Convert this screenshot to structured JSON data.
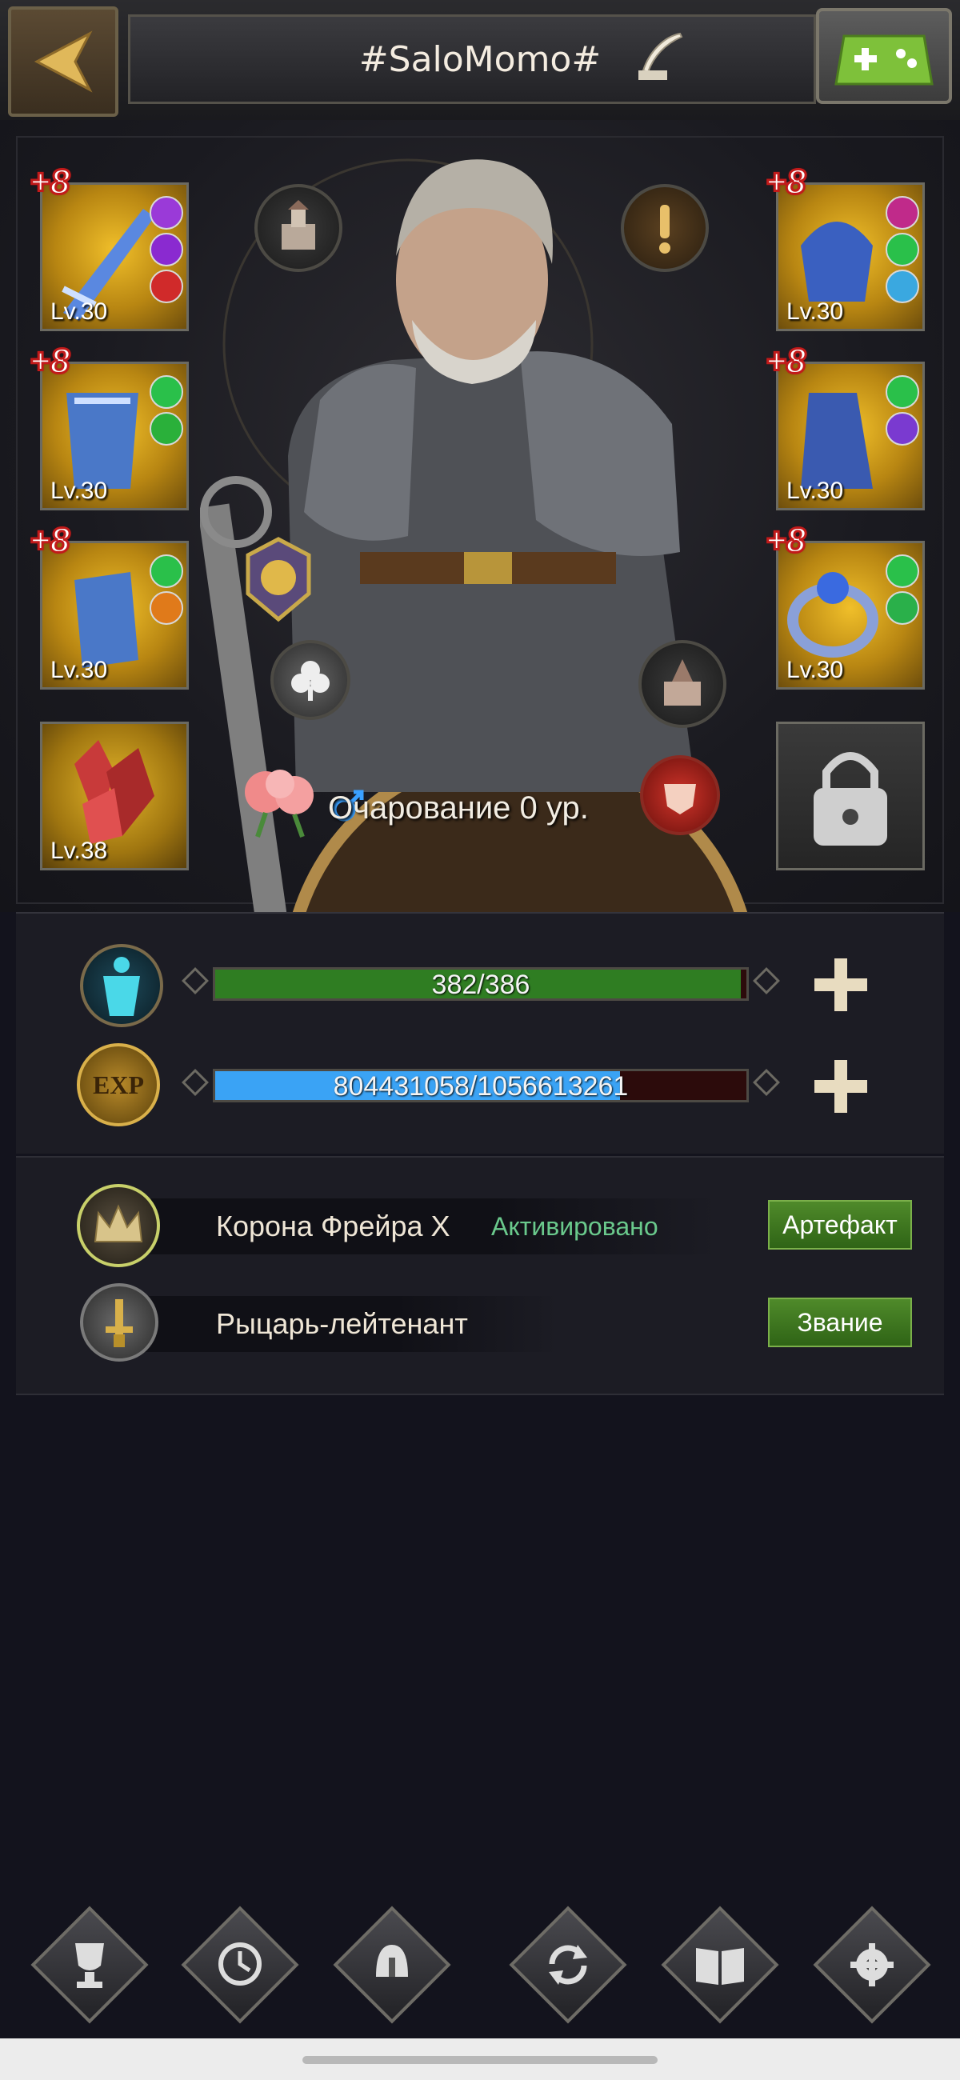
{
  "header": {
    "title": "#SaloMomo#"
  },
  "equipment": {
    "left": [
      {
        "plus": "+8",
        "level": "Lv.30"
      },
      {
        "plus": "+8",
        "level": "Lv.30"
      },
      {
        "plus": "+8",
        "level": "Lv.30"
      },
      {
        "plus": "",
        "level": "Lv.38"
      }
    ],
    "right": [
      {
        "plus": "+8",
        "level": "Lv.30"
      },
      {
        "plus": "+8",
        "level": "Lv.30"
      },
      {
        "plus": "+8",
        "level": "Lv.30"
      }
    ]
  },
  "charm": {
    "text": "Очарование 0 ур."
  },
  "stats": {
    "stamina": {
      "text": "382/386",
      "current": 382,
      "max": 386,
      "color": "#2f7d22"
    },
    "exp": {
      "text": "804431058/1056613261",
      "current": 804431058,
      "max": 1056613261,
      "color": "#3aa3f5",
      "badge": "EXP"
    }
  },
  "info": {
    "artifact_name": "Корона Фрейра X",
    "artifact_status": "Активировано",
    "artifact_button": "Артефакт",
    "rank_name": "Рыцарь-лейтенант",
    "rank_button": "Звание"
  },
  "colors": {
    "accent_green": "#3f7a20",
    "status_green": "#6ac98c",
    "gold": "#f0bf2a"
  }
}
